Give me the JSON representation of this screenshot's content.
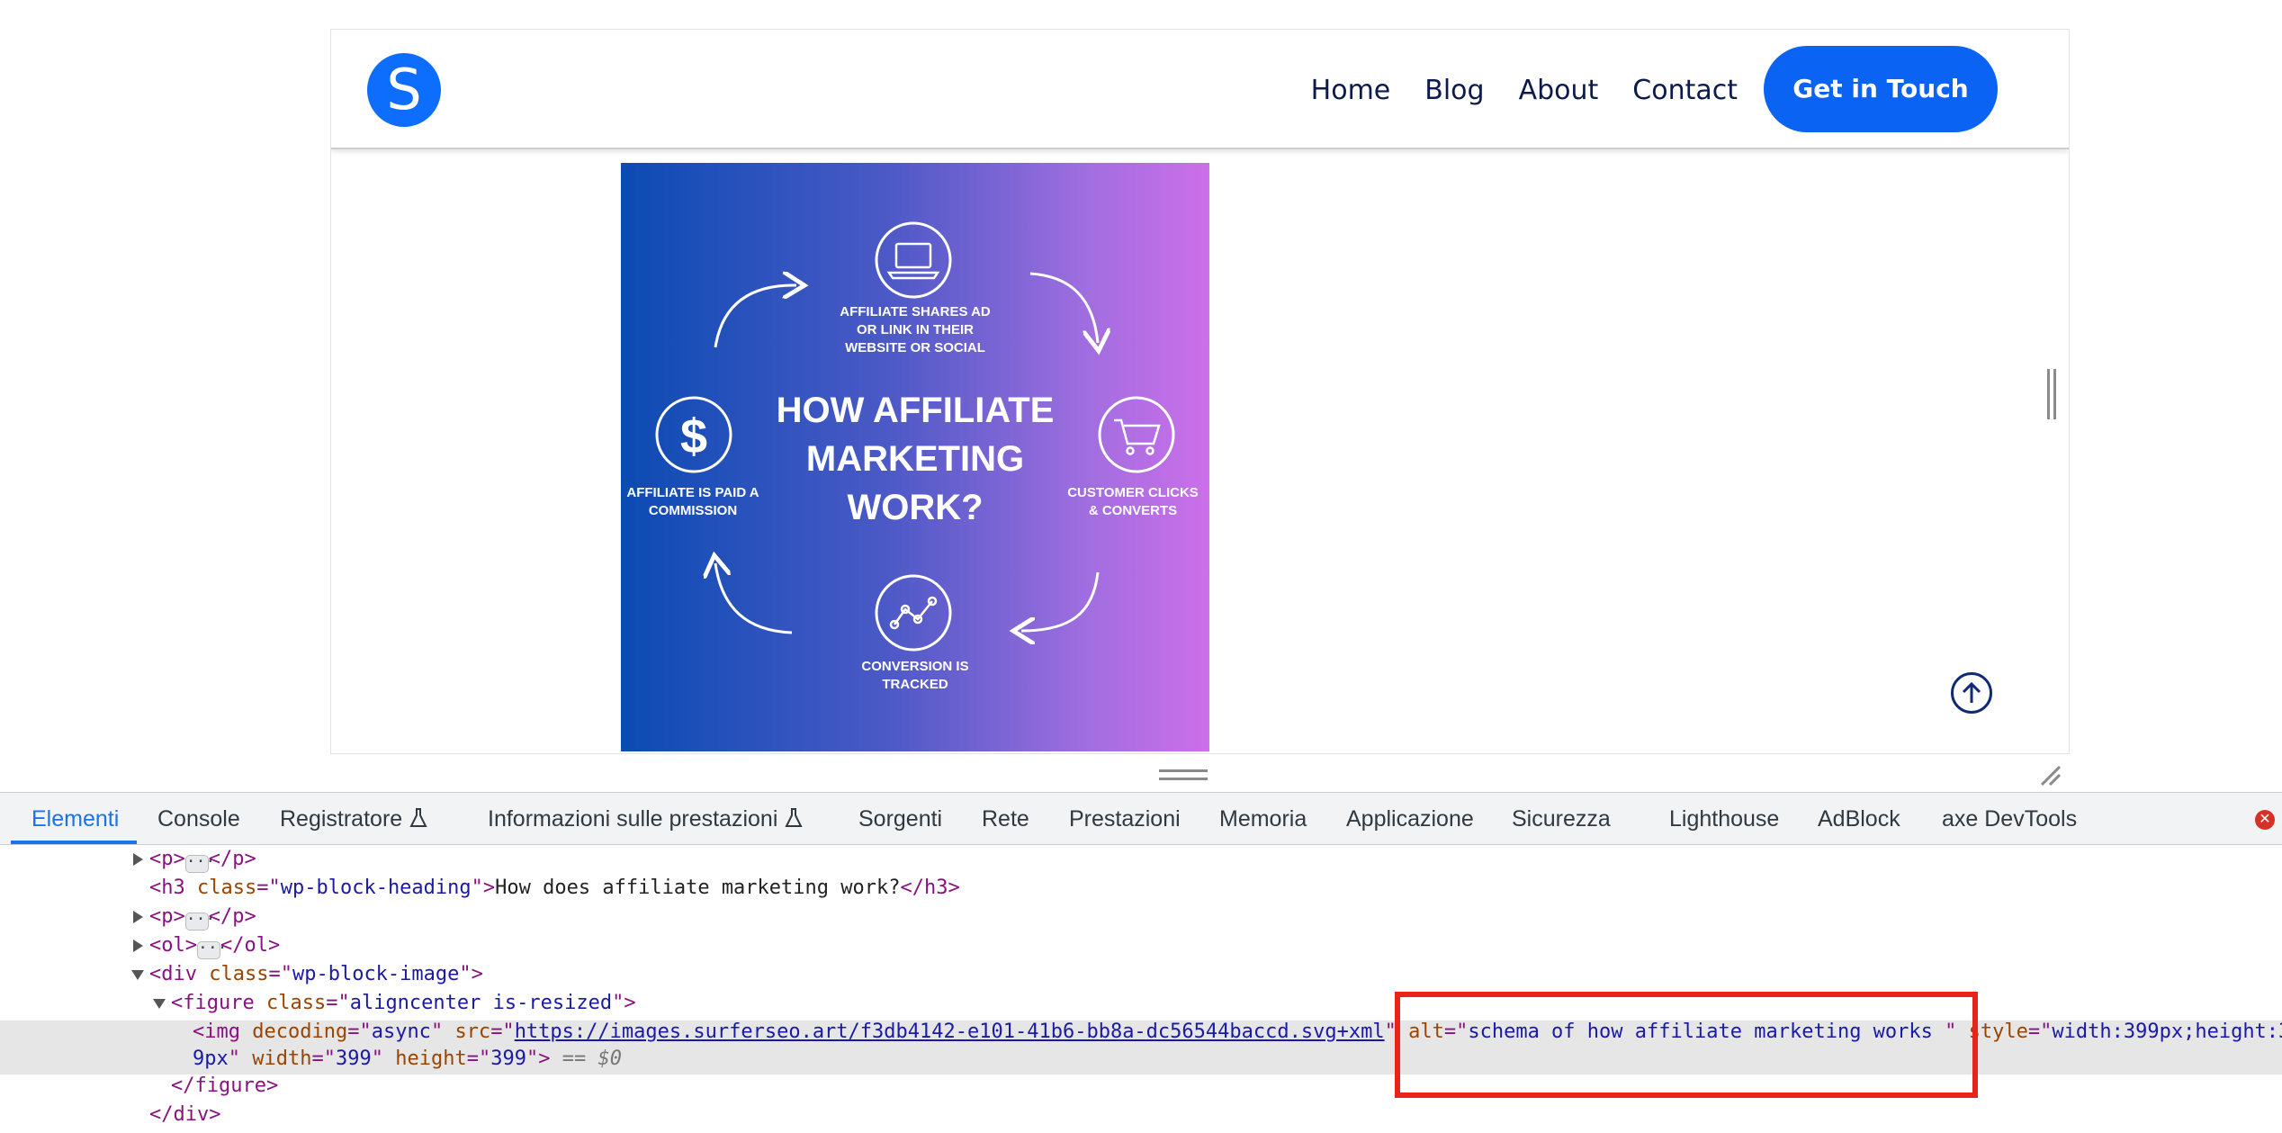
{
  "site": {
    "logo_letter": "S",
    "nav": [
      "Home",
      "Blog",
      "About",
      "Contact"
    ],
    "cta_label": "Get in Touch",
    "image": {
      "title": "HOW AFFILIATE MARKETING WORK?",
      "steps": {
        "shares": "AFFILIATE SHARES AD OR LINK IN THEIR WEBSITE OR SOCIAL",
        "clicks": "CUSTOMER CLICKS & CONVERTS",
        "tracked": "CONVERSION IS TRACKED",
        "paid": "AFFILIATE IS PAID A COMMISSION"
      },
      "gradient": [
        "#0b4bb3",
        "#cc6fe9"
      ]
    },
    "colors": {
      "brand": "#0b63f3",
      "nav_text": "#0c1a4c"
    }
  },
  "devtools": {
    "tabs": [
      "Elementi",
      "Console",
      "Registratore",
      "Informazioni sulle prestazioni",
      "Sorgenti",
      "Rete",
      "Prestazioni",
      "Memoria",
      "Applicazione",
      "Sicurezza",
      "Lighthouse",
      "AdBlock",
      "axe DevTools"
    ],
    "active_tab": "Elementi",
    "dom": {
      "h3_class": "wp-block-heading",
      "h3_text": "How does affiliate marketing work?",
      "div_class": "wp-block-image",
      "figure_class": "aligncenter is-resized",
      "img_decoding": "async",
      "img_src": "https://images.surferseo.art/f3db4142-e101-41b6-bb8a-dc56544baccd.svg+xml",
      "img_alt": "schema of how affiliate marketing works ",
      "img_style": "width:399px;height:3",
      "img_style_wrap": "9px",
      "img_width": "399",
      "img_height": "399",
      "selected_marker": "== $0"
    },
    "highlight_color": "#e8241a"
  }
}
